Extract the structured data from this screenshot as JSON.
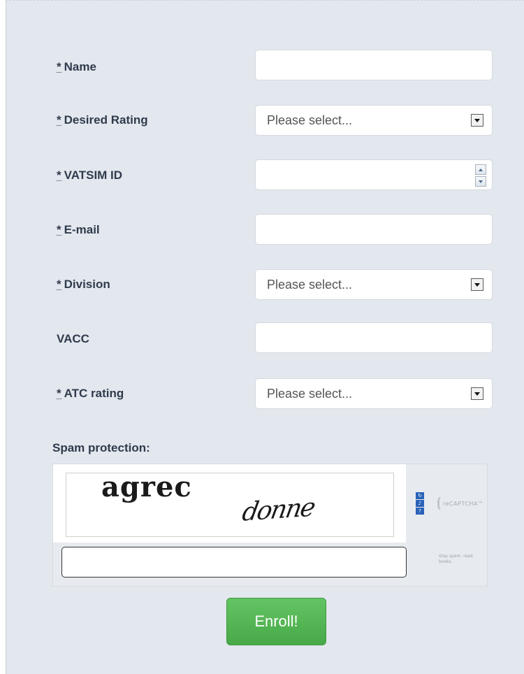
{
  "form": {
    "fields": [
      {
        "required_mark": "*",
        "label": "Name",
        "value": ""
      },
      {
        "required_mark": "*",
        "label": "Desired Rating",
        "selected": "Please select..."
      },
      {
        "required_mark": "*",
        "label": "VATSIM ID",
        "value": ""
      },
      {
        "required_mark": "*",
        "label": "E-mail",
        "value": ""
      },
      {
        "required_mark": "*",
        "label": "Division",
        "selected": "Please select..."
      },
      {
        "required_mark": "",
        "label": "VACC",
        "value": ""
      },
      {
        "required_mark": "*",
        "label": "ATC rating",
        "selected": "Please select..."
      }
    ],
    "spam_label": "Spam protection:",
    "captcha": {
      "word1": "agrec",
      "word2": "donne",
      "logo_text": "reCAPTCHA™",
      "tagline": "stop spam. read books.",
      "input_value": ""
    },
    "submit_label": "Enroll!"
  },
  "colors": {
    "panel_bg": "#e3e7ee",
    "label": "#2f3b4c",
    "button": "#5cb85c"
  }
}
